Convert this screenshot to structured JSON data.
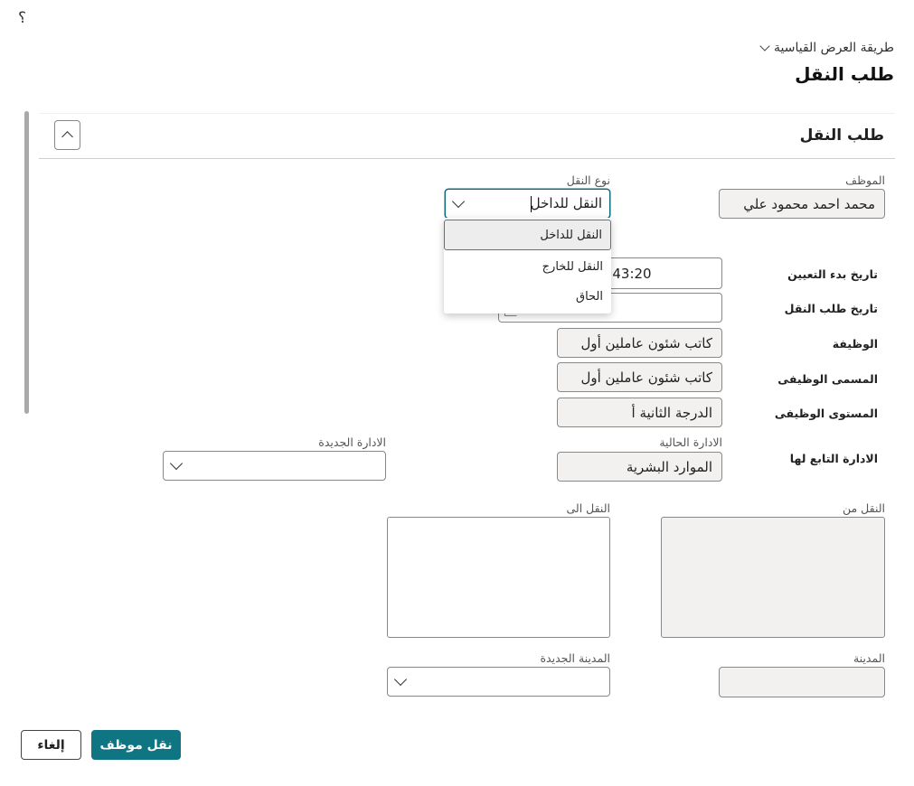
{
  "header": {
    "help_symbol": "؟",
    "view_mode_label": "طريقة العرض القياسية",
    "page_title": "طلب النقل"
  },
  "section": {
    "title": "طلب النقل"
  },
  "form": {
    "employee": {
      "label": "الموظف",
      "value": "محمد احمد محمود علي"
    },
    "transfer_type": {
      "label": "نوع النقل",
      "value": "النقل للداخل",
      "options": [
        "النقل للداخل",
        "النقل للخارج",
        "الحاق"
      ]
    },
    "hire_date": {
      "label": "تاريخ بدء التعيين",
      "value": "06/01/2010 13:43:20"
    },
    "request_date": {
      "label": "تاريخ طلب النقل",
      "value": ""
    },
    "job": {
      "label": "الوظيفة",
      "value": "كاتب شئون عاملين أول"
    },
    "job_title": {
      "label": "المسمى الوظيفى",
      "value": "كاتب شئون عاملين أول"
    },
    "job_level": {
      "label": "المستوى الوظيفى",
      "value": "الدرجة الثانية أ"
    },
    "department_row_label": "الادارة التابع لها",
    "current_department": {
      "label": "الادارة الحالية",
      "value": "الموارد البشرية"
    },
    "new_department": {
      "label": "الادارة الجديدة",
      "value": ""
    },
    "transfer_from": {
      "label": "النقل من",
      "value": ""
    },
    "transfer_to": {
      "label": "النقل الى",
      "value": ""
    },
    "city": {
      "label": "المدينة",
      "value": ""
    },
    "new_city": {
      "label": "المدينة الجديدة",
      "value": ""
    }
  },
  "actions": {
    "submit_label": "نقل موظف",
    "cancel_label": "إلغاء"
  },
  "colors": {
    "primary": "#0f7582",
    "focus_border": "#0f6c7a",
    "readonly_bg": "#f2f1f0"
  }
}
